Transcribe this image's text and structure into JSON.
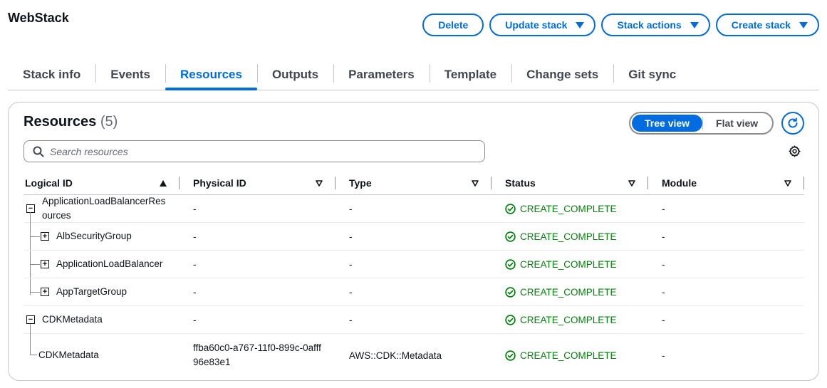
{
  "stack": {
    "title": "WebStack"
  },
  "actions": {
    "delete": "Delete",
    "update": "Update stack",
    "stack_actions": "Stack actions",
    "create": "Create stack"
  },
  "tabs": [
    {
      "label": "Stack info"
    },
    {
      "label": "Events"
    },
    {
      "label": "Resources"
    },
    {
      "label": "Outputs"
    },
    {
      "label": "Parameters"
    },
    {
      "label": "Template"
    },
    {
      "label": "Change sets"
    },
    {
      "label": "Git sync"
    }
  ],
  "active_tab": "Resources",
  "resources": {
    "title": "Resources",
    "count": "(5)",
    "view_tree": "Tree view",
    "view_flat": "Flat view",
    "search_placeholder": "Search resources",
    "columns": [
      "Logical ID",
      "Physical ID",
      "Type",
      "Status",
      "Module"
    ],
    "rows": [
      {
        "logical_id": "ApplicationLoadBalancerResources",
        "physical_id": "-",
        "type": "-",
        "status": "CREATE_COMPLETE",
        "module": "-"
      },
      {
        "logical_id": "AlbSecurityGroup",
        "physical_id": "-",
        "type": "-",
        "status": "CREATE_COMPLETE",
        "module": "-"
      },
      {
        "logical_id": "ApplicationLoadBalancer",
        "physical_id": "-",
        "type": "-",
        "status": "CREATE_COMPLETE",
        "module": "-"
      },
      {
        "logical_id": "AppTargetGroup",
        "physical_id": "-",
        "type": "-",
        "status": "CREATE_COMPLETE",
        "module": "-"
      },
      {
        "logical_id": "CDKMetadata",
        "physical_id": "-",
        "type": "-",
        "status": "CREATE_COMPLETE",
        "module": "-"
      },
      {
        "logical_id": "CDKMetadata",
        "physical_id": "ffba60c0-a767-11f0-899c-0afff96e83e1",
        "type": "AWS::CDK::Metadata",
        "status": "CREATE_COMPLETE",
        "module": "-"
      }
    ]
  },
  "colors": {
    "accent": "#006ce0",
    "success": "#037f0c",
    "text": "#0f141a"
  }
}
